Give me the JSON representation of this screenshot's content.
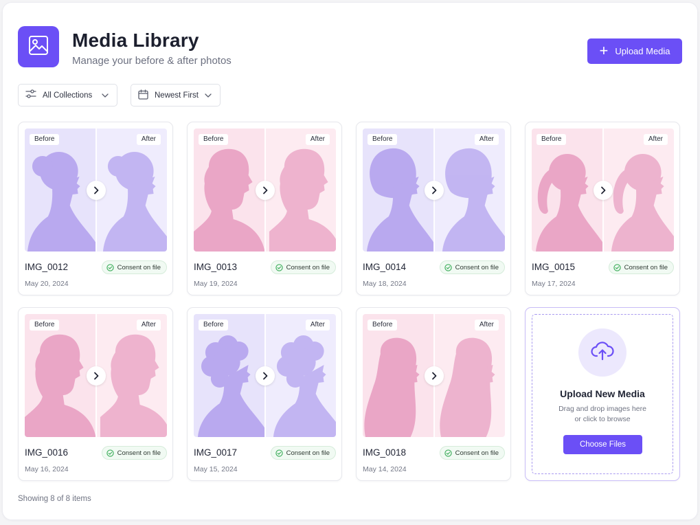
{
  "header": {
    "title": "Media Library",
    "subtitle": "Manage your before & after photos",
    "upload_label": "Upload Media"
  },
  "filters": {
    "collection": "All Collections",
    "sort": "Newest First"
  },
  "labels": {
    "before": "Before",
    "after": "After",
    "consent": "Consent on file"
  },
  "items": [
    {
      "name": "IMG_0012",
      "date": "May 20, 2024",
      "palette": "purple",
      "silhouette": "bun"
    },
    {
      "name": "IMG_0013",
      "date": "May 19, 2024",
      "palette": "pink",
      "silhouette": "man"
    },
    {
      "name": "IMG_0014",
      "date": "May 18, 2024",
      "palette": "purple",
      "silhouette": "bob"
    },
    {
      "name": "IMG_0015",
      "date": "May 17, 2024",
      "palette": "pink",
      "silhouette": "ponytail"
    },
    {
      "name": "IMG_0016",
      "date": "May 16, 2024",
      "palette": "pink",
      "silhouette": "man"
    },
    {
      "name": "IMG_0017",
      "date": "May 15, 2024",
      "palette": "purple",
      "silhouette": "curly"
    },
    {
      "name": "IMG_0018",
      "date": "May 14, 2024",
      "palette": "pink",
      "silhouette": "longhair"
    }
  ],
  "upload_card": {
    "title": "Upload New Media",
    "hint_line1": "Drag and drop images here",
    "hint_line2": "or click to browse",
    "button_label": "Choose Files"
  },
  "footer": {
    "status": "Showing 8 of 8 items"
  },
  "colors": {
    "accent": "#6b4ff6",
    "purple_bg_before": "#e7e3fb",
    "purple_bg_after": "#efecfd",
    "purple_figure": "#b9a9ef",
    "pink_bg_before": "#fbe3ec",
    "pink_bg_after": "#fdebf1",
    "pink_figure": "#eaa6c6",
    "consent_green": "#3fae5c"
  },
  "icons": {
    "logo": "image-icon",
    "upload": "plus-icon",
    "filter": "sliders-icon",
    "sort": "calendar-icon",
    "dropdown": "chevron-down-icon",
    "compare": "chevron-right-icon",
    "consent": "check-circle-icon",
    "dropzone": "cloud-upload-icon"
  }
}
